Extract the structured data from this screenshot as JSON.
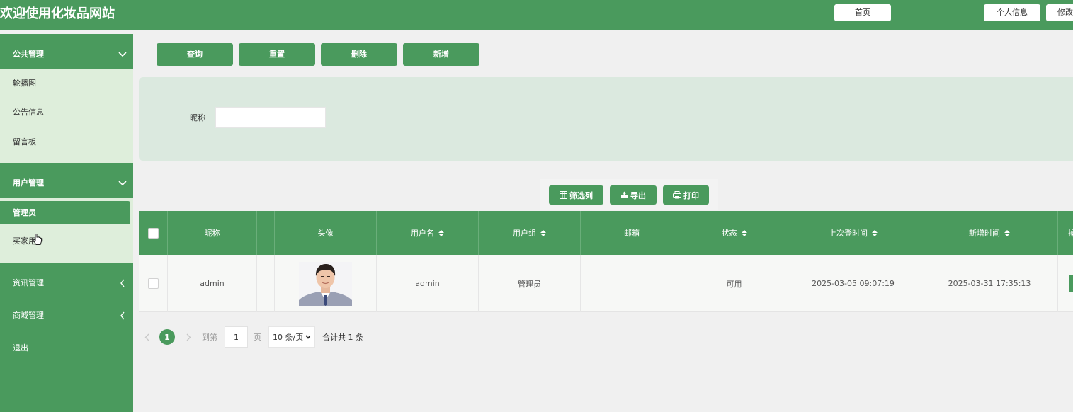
{
  "header": {
    "title": "欢迎使用化妆品网站",
    "home_label": "首页",
    "profile_label": "个人信息",
    "change_label": "修改密码"
  },
  "sidebar": {
    "groups": [
      {
        "label": "公共管理",
        "expanded": true,
        "items": [
          "轮播图",
          "公告信息",
          "留言板"
        ]
      },
      {
        "label": "用户管理",
        "expanded": true,
        "items": [
          "管理员",
          "买家用户"
        ],
        "active": "管理员"
      },
      {
        "label": "资讯管理",
        "expanded": false
      },
      {
        "label": "商城管理",
        "expanded": false
      },
      {
        "label": "退出",
        "expanded": false
      }
    ]
  },
  "actions": {
    "query": "查询",
    "reset": "重置",
    "delete": "删除",
    "add": "新增"
  },
  "search": {
    "label": "昵称",
    "value": ""
  },
  "toolbar": {
    "filter_cols": "筛选列",
    "export": "导出",
    "print": "打印"
  },
  "table": {
    "columns": [
      "昵称",
      "头像",
      "用户名",
      "用户组",
      "邮箱",
      "状态",
      "上次登时间",
      "新增时间",
      "操作"
    ],
    "rows": [
      {
        "nickname": "admin",
        "username": "admin",
        "group": "管理员",
        "email": "",
        "status": "可用",
        "last_login": "2025-03-05 09:07:19",
        "created": "2025-03-31 17:35:13"
      }
    ]
  },
  "pagination": {
    "current_page": "1",
    "goto_label": "到第",
    "page_input": "1",
    "page_suffix": "页",
    "page_size": "10 条/页",
    "total": "合计共 1 条"
  },
  "colors": {
    "primary": "#4a9a5d",
    "submenu_bg": "#deeedb",
    "search_bg": "#dbe9df"
  }
}
